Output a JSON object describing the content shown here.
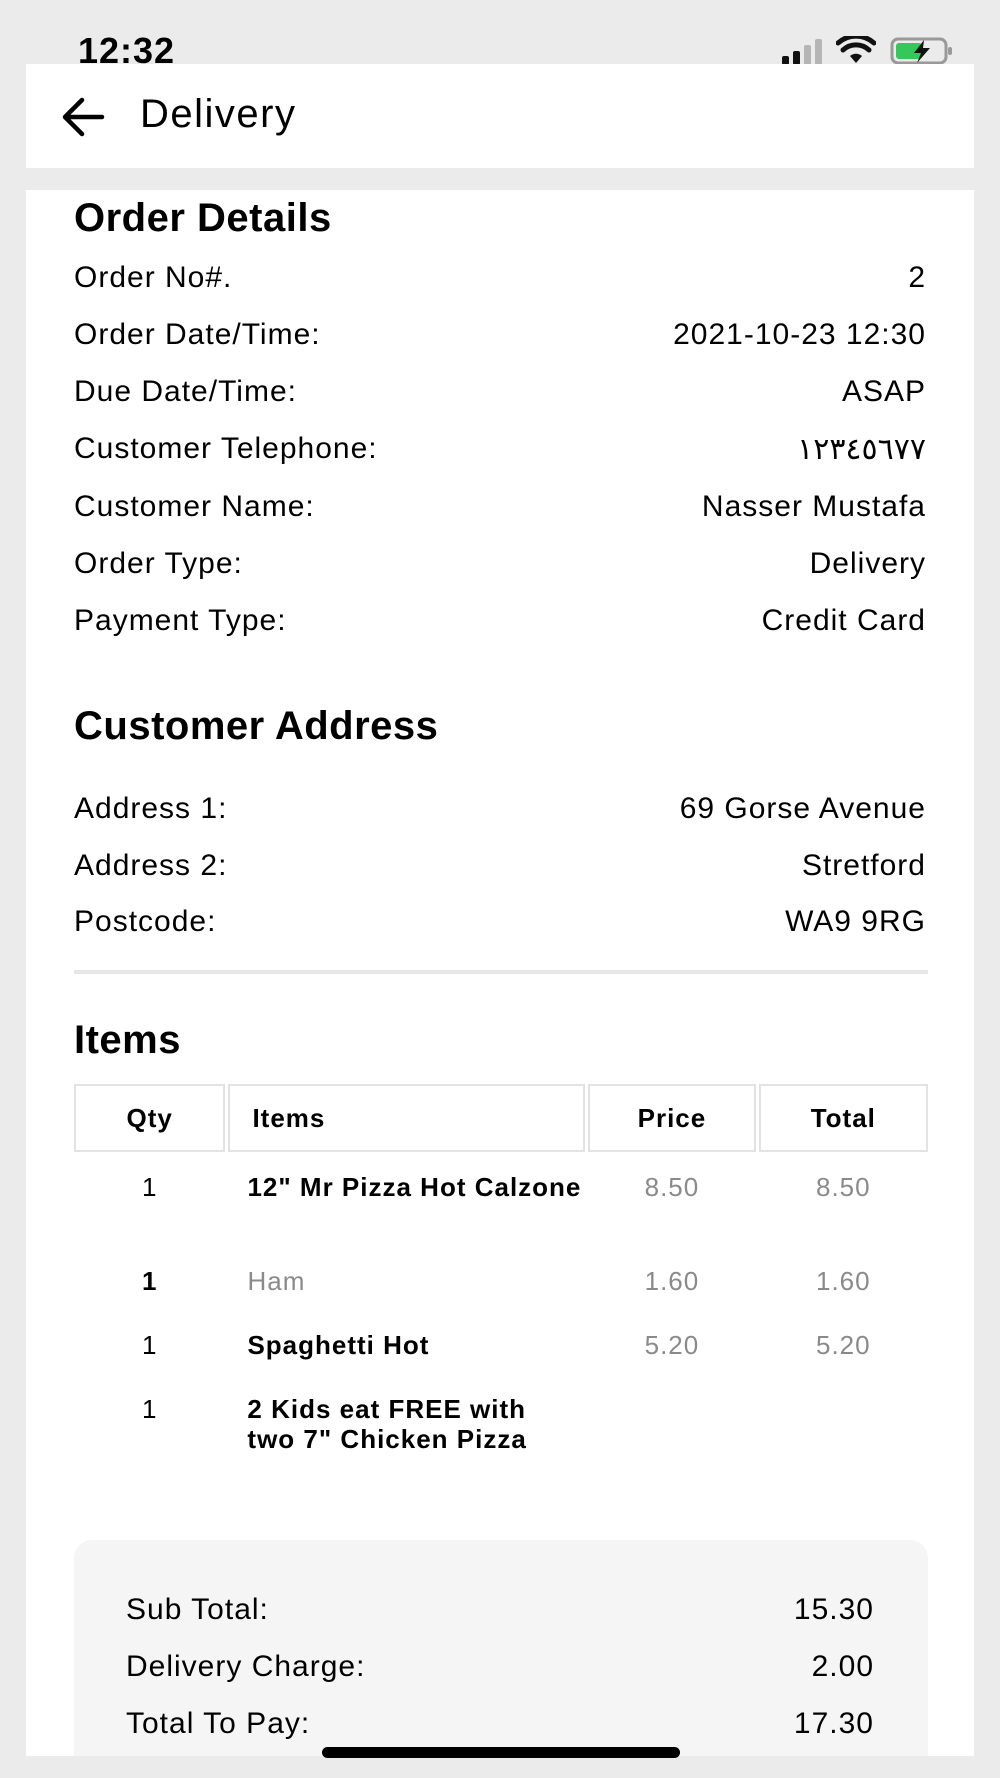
{
  "status_bar": {
    "time": "12:32",
    "icons": [
      "signal-icon",
      "wifi-icon",
      "battery-charging-icon"
    ],
    "battery_color": "#34c759"
  },
  "header": {
    "back_icon": "arrow-left-icon",
    "title": "Delivery"
  },
  "order_details": {
    "title": "Order Details",
    "rows": [
      {
        "label": "Order No#.",
        "value": "2"
      },
      {
        "label": "Order Date/Time:",
        "value": "2021-10-23 12:30"
      },
      {
        "label": "Due Date/Time:",
        "value": "ASAP"
      },
      {
        "label": "Customer Telephone:",
        "value": "١٢٣٤٥٦٧٧"
      },
      {
        "label": "Customer Name:",
        "value": "Nasser Mustafa"
      },
      {
        "label": "Order Type:",
        "value": "Delivery"
      },
      {
        "label": "Payment Type:",
        "value": "Credit Card"
      }
    ]
  },
  "customer_address": {
    "title": "Customer Address",
    "rows": [
      {
        "label": "Address 1:",
        "value": "69 Gorse Avenue"
      },
      {
        "label": "Address 2:",
        "value": "Stretford"
      },
      {
        "label": "Postcode:",
        "value": "WA9 9RG"
      }
    ]
  },
  "items": {
    "title": "Items",
    "columns": [
      "Qty",
      "Items",
      "Price",
      "Total"
    ],
    "rows": [
      {
        "qty": "1",
        "item": "12\" Mr Pizza Hot Calzone",
        "price": "8.50",
        "total": "8.50"
      },
      {
        "qty": "1",
        "item": "Ham",
        "price": "1.60",
        "total": "1.60"
      },
      {
        "qty": "1",
        "item": "Spaghetti Hot",
        "price": "5.20",
        "total": "5.20"
      },
      {
        "qty": "1",
        "item": "2 Kids eat FREE with two 7\" Chicken Pizza",
        "price": "",
        "total": ""
      }
    ]
  },
  "totals": {
    "rows": [
      {
        "label": "Sub Total:",
        "value": "15.30"
      },
      {
        "label": "Delivery Charge:",
        "value": "2.00"
      },
      {
        "label": "Total To Pay:",
        "value": "17.30"
      }
    ]
  }
}
